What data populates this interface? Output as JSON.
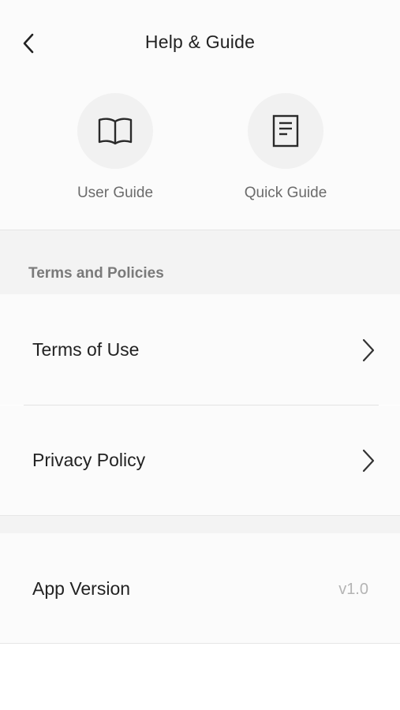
{
  "header": {
    "title": "Help & Guide",
    "back_icon": "chevron-left-icon"
  },
  "guides": [
    {
      "label": "User Guide",
      "icon": "open-book-icon"
    },
    {
      "label": "Quick Guide",
      "icon": "document-icon"
    }
  ],
  "terms_section": {
    "title": "Terms and Policies",
    "items": [
      {
        "label": "Terms of Use",
        "icon": "chevron-right-icon"
      },
      {
        "label": "Privacy Policy",
        "icon": "chevron-right-icon"
      }
    ]
  },
  "app_info": {
    "label": "App Version",
    "value": "v1.0"
  },
  "colors": {
    "background": "#fbfbfb",
    "section_background": "#f3f3f3",
    "primary_text": "#222222",
    "secondary_text": "#6b6b6b",
    "muted_text": "#b4b4b4"
  }
}
